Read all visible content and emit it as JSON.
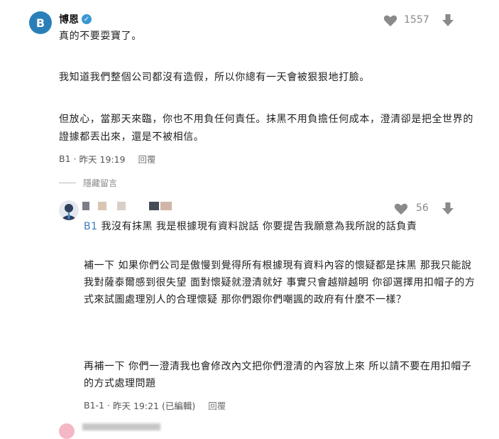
{
  "main_comment": {
    "avatar_letter": "B",
    "author": "博恩",
    "paragraphs": [
      "真的不要耍寶了。",
      "我知道我們整個公司都沒有造假，所以你總有一天會被狠狠地打臉。",
      "但放心，當那天來臨，你也不用負任何責任。抹黑不用負擔任何成本，澄清卻是把全世界的證據都丟出來，還是不被相信。"
    ],
    "floor": "B1",
    "time": "昨天 19:19",
    "reply_label": "回覆",
    "likes": "1557"
  },
  "hidden_comments_label": "隱藏留言",
  "reply_comment": {
    "floor_tag": "B1",
    "paragraphs": [
      "我沒有抹黑 我是根據現有資料說話 你要提告我願意為我所說的話負責",
      "補一下 如果你們公司是傲慢到覺得所有根據現有資料內容的懷疑都是抹黑 那我只能說我對薩泰爾感到很失望 面對懷疑就澄清就好 事實只會越辯越明 你卻選擇用扣帽子的方式來試圖處理別人的合理懷疑 那你們跟你們嘲諷的政府有什麼不一樣？",
      "再補一下 你們一澄清我也會修改內文把你們澄清的內容放上來 所以請不要在用扣帽子的方式處理問題"
    ],
    "floor": "B1-1",
    "time": "昨天 19:21 (已編輯)",
    "reply_label": "回覆",
    "likes": "56"
  },
  "colors": {
    "avatar_blue": "#2a7fb8",
    "verified_blue": "#3b97d3",
    "floor_tag_blue": "#3b7bbf",
    "icon_gray": "#8a8a8a"
  }
}
